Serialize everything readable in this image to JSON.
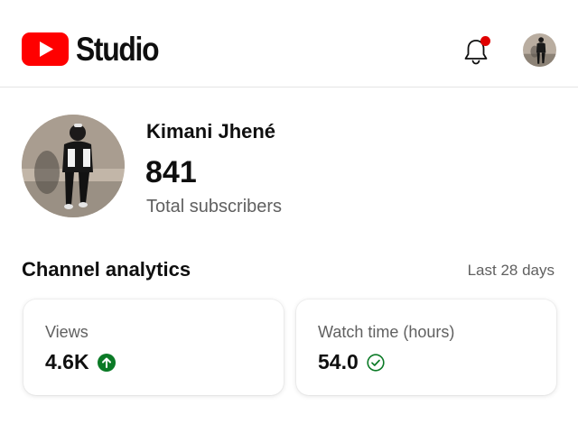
{
  "header": {
    "app_name": "Studio",
    "logo_icon": "youtube-logo-icon",
    "notification_icon": "bell-icon",
    "brand_color": "#FF0000",
    "notification_dot_color": "#E00000"
  },
  "channel": {
    "name": "Kimani Jhené",
    "subscriber_count": "841",
    "subscriber_label": "Total subscribers"
  },
  "analytics": {
    "title": "Channel analytics",
    "period": "Last 28 days",
    "cards": [
      {
        "label": "Views",
        "value": "4.6K",
        "status_icon": "arrow-up-circle-icon",
        "status_color": "#0B7A26"
      },
      {
        "label": "Watch time (hours)",
        "value": "54.0",
        "status_icon": "check-circle-icon",
        "status_color": "#0B7A26"
      }
    ]
  }
}
